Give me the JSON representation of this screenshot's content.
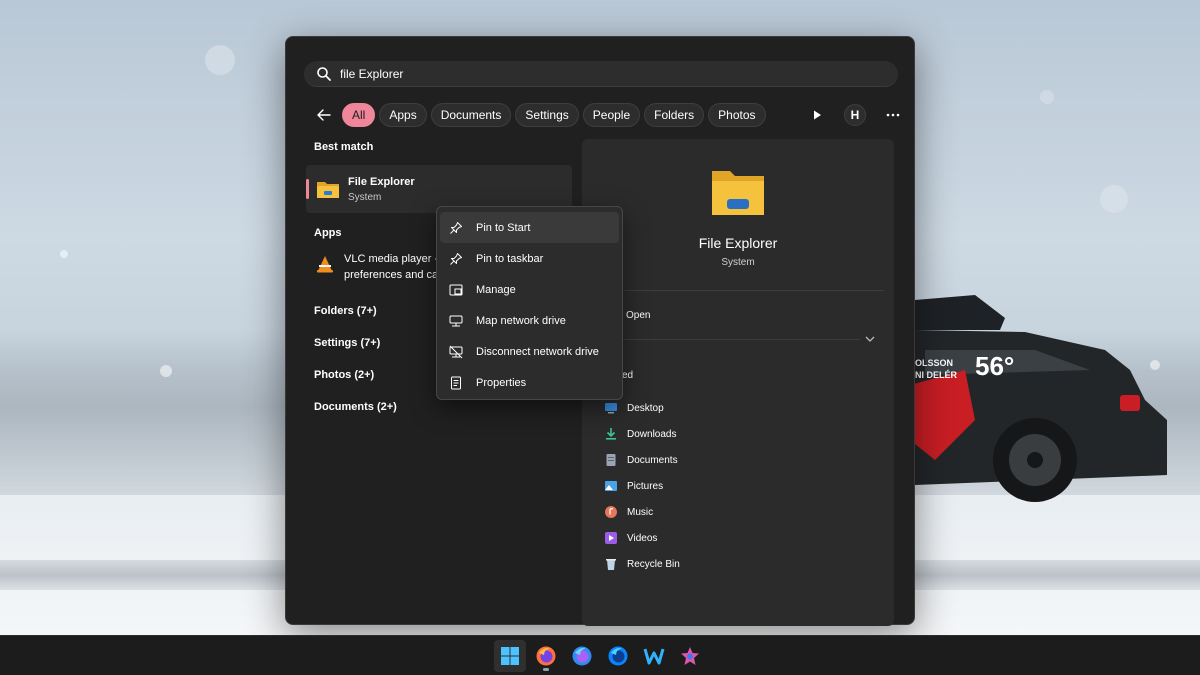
{
  "search": {
    "query": "file Explorer"
  },
  "filters": {
    "chips": [
      {
        "label": "All",
        "active": true
      },
      {
        "label": "Apps",
        "active": false
      },
      {
        "label": "Documents",
        "active": false
      },
      {
        "label": "Settings",
        "active": false
      },
      {
        "label": "People",
        "active": false
      },
      {
        "label": "Folders",
        "active": false
      },
      {
        "label": "Photos",
        "active": false
      }
    ],
    "avatar_letter": "H"
  },
  "results": {
    "best_match_heading": "Best match",
    "best_match": {
      "title": "File Explorer",
      "subtitle": "System"
    },
    "apps_heading": "Apps",
    "apps": [
      {
        "line1": "VLC media player -",
        "line2": "preferences and cache"
      }
    ],
    "categories": [
      "Folders (7+)",
      "Settings (7+)",
      "Photos (2+)",
      "Documents (2+)"
    ]
  },
  "preview": {
    "title": "File Explorer",
    "subtitle": "System",
    "open_label": "Open",
    "recent_label": "ed",
    "items": [
      {
        "label": "Desktop",
        "icon": "desktop-icon",
        "color": "#3a8ee6"
      },
      {
        "label": "Downloads",
        "icon": "downloads-icon",
        "color": "#3cc49a"
      },
      {
        "label": "Documents",
        "icon": "documents-icon",
        "color": "#9aa4b2"
      },
      {
        "label": "Pictures",
        "icon": "pictures-icon",
        "color": "#4aa3e8"
      },
      {
        "label": "Music",
        "icon": "music-icon",
        "color": "#e8765a"
      },
      {
        "label": "Videos",
        "icon": "videos-icon",
        "color": "#9b5de5"
      },
      {
        "label": "Recycle Bin",
        "icon": "recycle-bin-icon",
        "color": "#bcd4e6"
      }
    ]
  },
  "context_menu": {
    "items": [
      {
        "label": "Pin to Start",
        "icon": "pin-icon"
      },
      {
        "label": "Pin to taskbar",
        "icon": "pin-icon"
      },
      {
        "label": "Manage",
        "icon": "manage-icon"
      },
      {
        "label": "Map network drive",
        "icon": "network-drive-icon"
      },
      {
        "label": "Disconnect network drive",
        "icon": "disconnect-drive-icon"
      },
      {
        "label": "Properties",
        "icon": "properties-icon"
      }
    ]
  },
  "colors": {
    "accent": "#f0869a",
    "folder_yellow": "#f5c23e",
    "panel": "#202020"
  },
  "wallpaper": {
    "car_number": "56°",
    "car_text_line1": "OLSSON",
    "car_text_line2": "NI DELÉR"
  }
}
